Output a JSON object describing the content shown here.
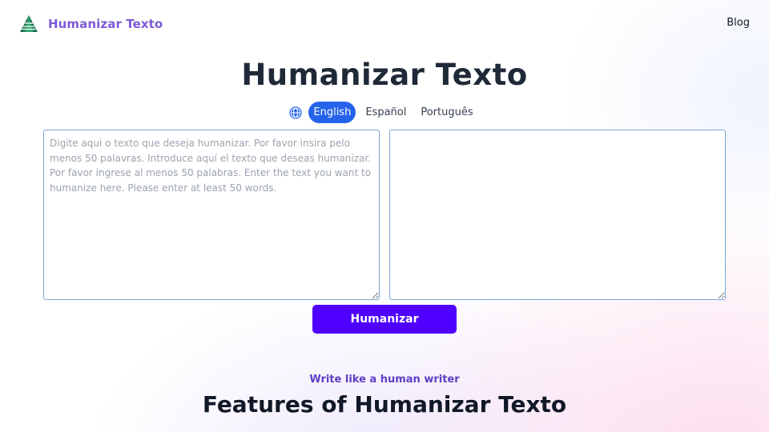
{
  "nav": {
    "brand_name": "Humanizar Texto",
    "logo_icon": "pyramid-logo-icon",
    "blog_label": "Blog"
  },
  "hero": {
    "title": "Humanizar Texto"
  },
  "languages": {
    "icon": "globe-icon",
    "options": [
      "English",
      "Español",
      "Português"
    ],
    "selected": "English"
  },
  "editor": {
    "input_placeholder": "Digite aqui o texto que deseja humanizar. Por favor insira pelo menos 50 palavras. Introduce aquí el texto que deseas humanizar. Por favor ingrese al menos 50 palabras. Enter the text you want to humanize here. Please enter at least 50 words.",
    "input_value": "",
    "output_value": ""
  },
  "actions": {
    "humanize_label": "Humanizar"
  },
  "features": {
    "eyebrow": "Write like a human writer",
    "title": "Features of Humanizar Texto"
  },
  "colors": {
    "brand": "#7b5bd6",
    "primary_button": "#4f00ff",
    "active_language": "#2563eb",
    "logo_green": "#1f8a5b"
  }
}
